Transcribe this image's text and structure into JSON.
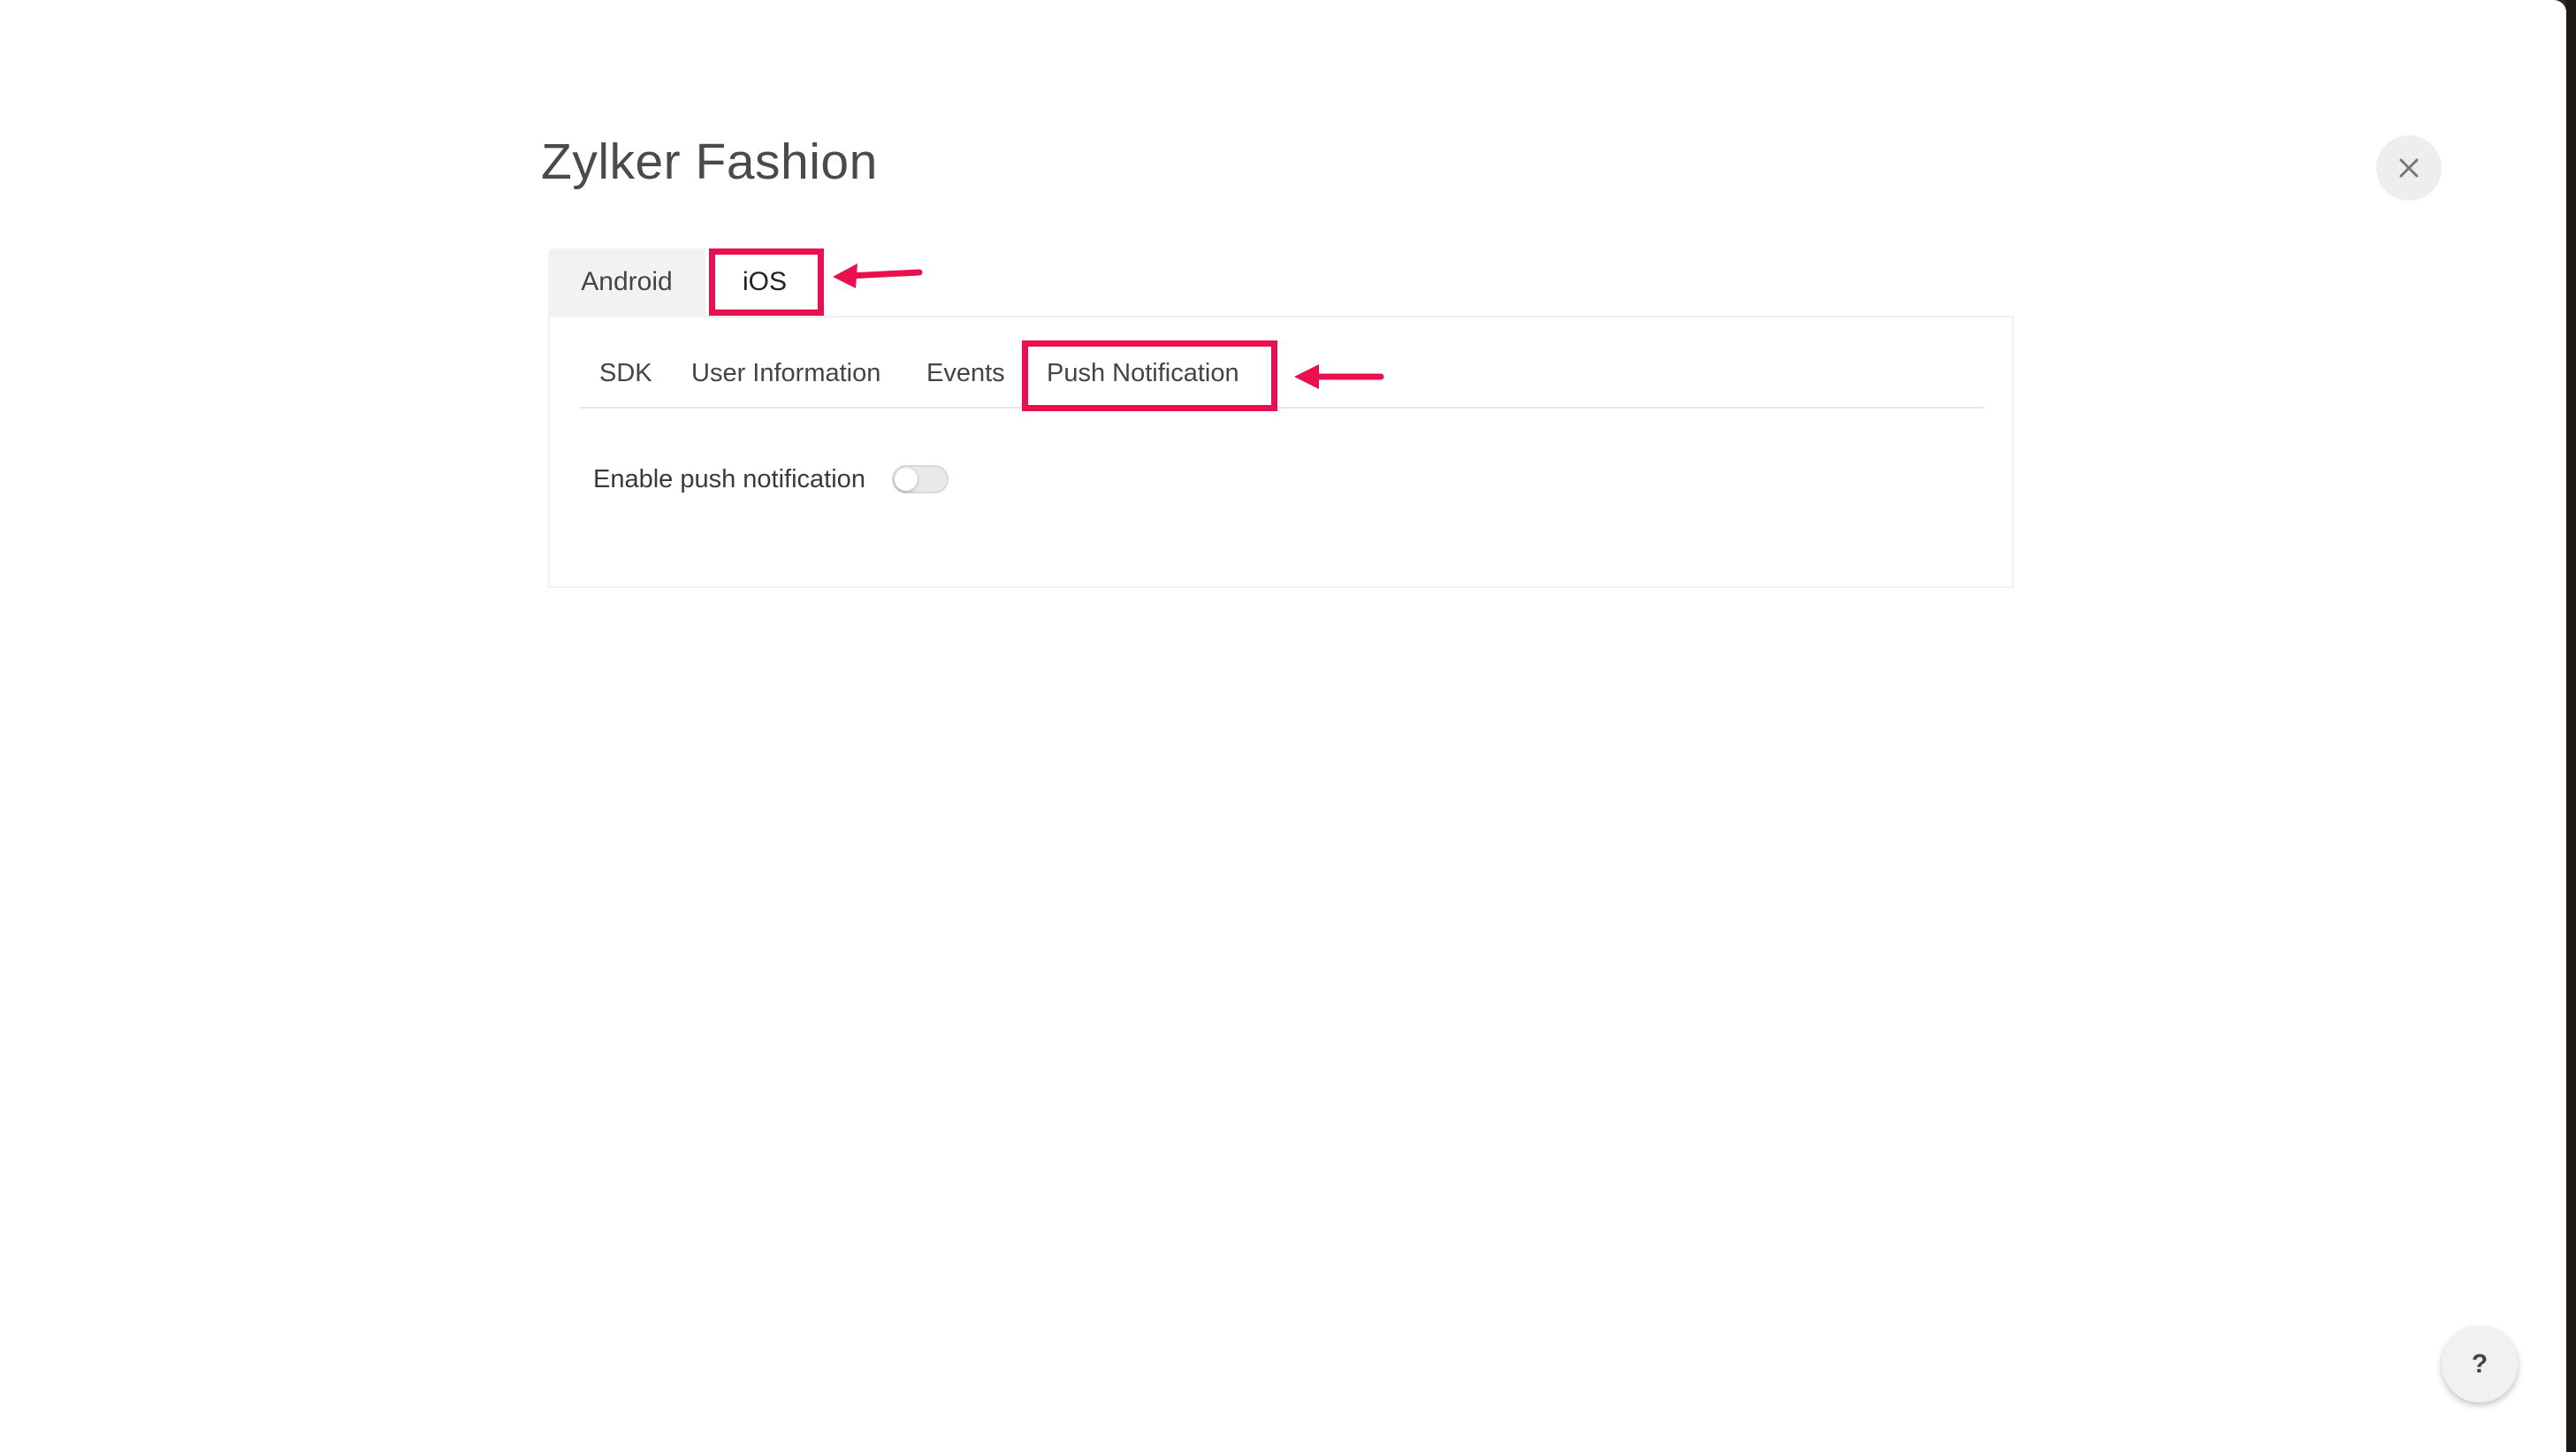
{
  "modal": {
    "title": "Zylker Fashion",
    "close_label": "×"
  },
  "platform_tabs": [
    {
      "label": "Android",
      "active": false
    },
    {
      "label": "iOS",
      "active": true
    }
  ],
  "sub_tabs": [
    {
      "label": "SDK",
      "active": false
    },
    {
      "label": "User Information",
      "active": false
    },
    {
      "label": "Events",
      "active": false
    },
    {
      "label": "Push Notification",
      "active": true
    }
  ],
  "push_settings": {
    "enable_label": "Enable push notification",
    "enabled": false
  },
  "help": {
    "label": "?"
  },
  "annotation_color": "#e8104f",
  "icons": {
    "close": "close-icon",
    "help": "help-icon",
    "annotation_arrow": "arrow-left-icon"
  }
}
